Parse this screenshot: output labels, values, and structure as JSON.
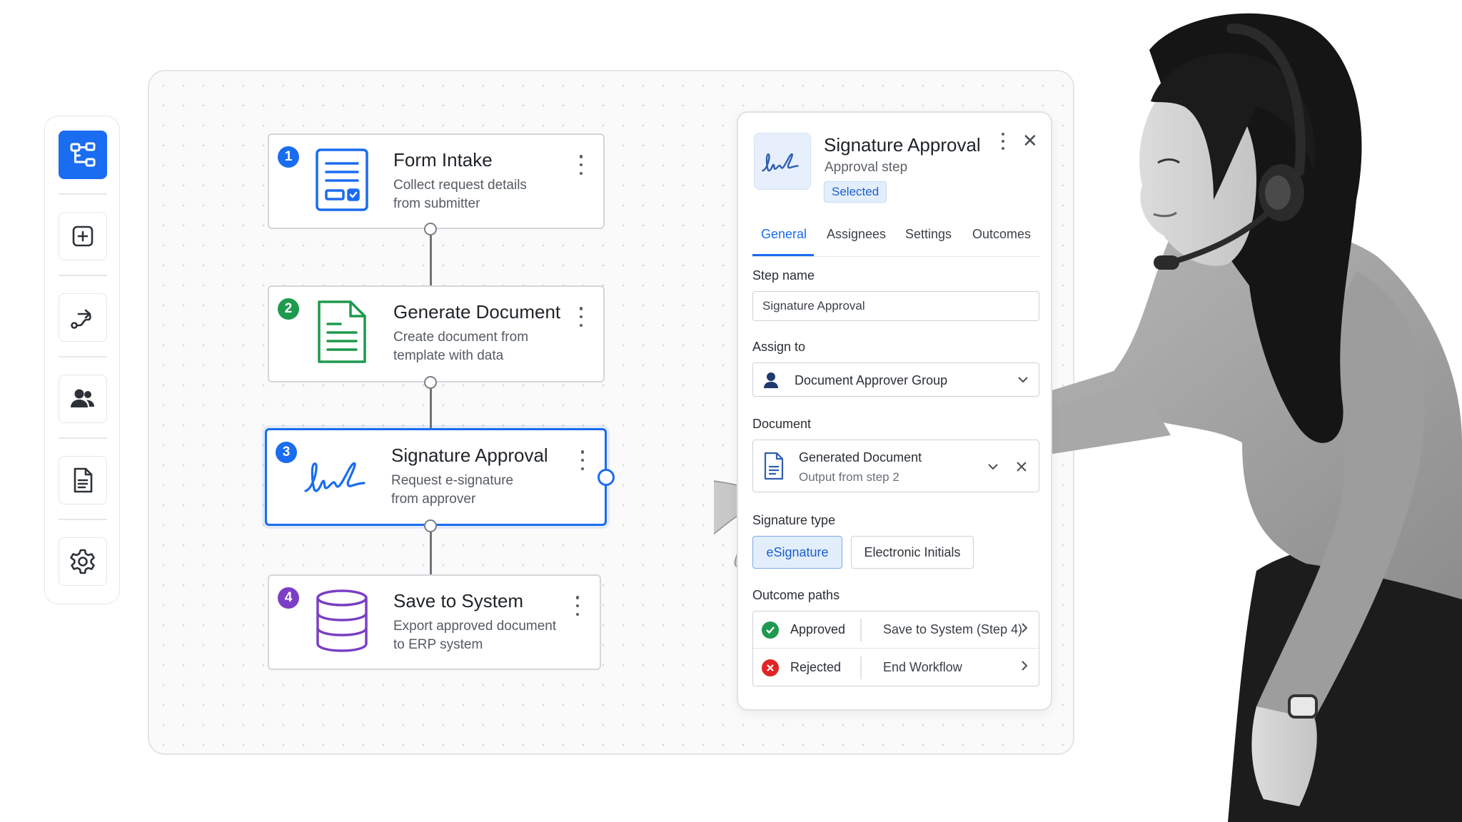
{
  "flow": {
    "steps": [
      {
        "number": "1",
        "title": "Form Intake",
        "desc_line1": "Collect request details",
        "desc_line2": "from submitter",
        "badge_color": "#1a6cf0",
        "icon": "form-icon"
      },
      {
        "number": "2",
        "title": "Generate Document",
        "desc_line1": "Create document from",
        "desc_line2": "template with data",
        "badge_color": "#1e9a4f",
        "icon": "document-icon"
      },
      {
        "number": "3",
        "title": "Signature Approval",
        "desc_line1": "Request e-signature",
        "desc_line2": "from approver",
        "badge_color": "#1a6cf0",
        "icon": "signature-icon",
        "selected": true
      },
      {
        "number": "4",
        "title": "Save to System",
        "desc_line1": "Export approved document",
        "desc_line2": "to ERP system",
        "badge_color": "#7a3fc4",
        "icon": "database-icon"
      }
    ]
  },
  "sidebar": {
    "items": [
      {
        "name": "workflow-icon",
        "active": true
      },
      {
        "name": "add-step-icon"
      },
      {
        "name": "route-icon"
      },
      {
        "name": "users-icon"
      },
      {
        "name": "document-icon"
      },
      {
        "name": "settings-gear-icon"
      }
    ]
  },
  "panel": {
    "title": "Signature Approval",
    "subtitle": "Approval step",
    "chip": "Selected",
    "tabs": [
      "General",
      "Assignees",
      "Settings",
      "Outcomes"
    ],
    "active_tab": "General",
    "step_name_label": "Step name",
    "step_name_value": "Signature Approval",
    "assign_label": "Assign to",
    "assign_value": "Document Approver Group",
    "document_label": "Document",
    "document_name": "Generated Document",
    "document_sub": "Output from step 2",
    "sigtype_label": "Signature type",
    "sigtype_options": [
      "eSignature",
      "Electronic Initials"
    ],
    "sigtype_selected": "eSignature",
    "outcomes_label": "Outcome paths",
    "outcomes": [
      {
        "label": "Approved",
        "target": "Save to System (Step 4)",
        "status": "success",
        "color": "#1e9a4f"
      },
      {
        "label": "Rejected",
        "target": "End Workflow",
        "status": "error",
        "color": "#e02424"
      }
    ]
  },
  "colors": {
    "accent": "#1a6cf0",
    "success": "#1e9a4f",
    "error": "#e02424",
    "purple": "#7a3fc4"
  }
}
